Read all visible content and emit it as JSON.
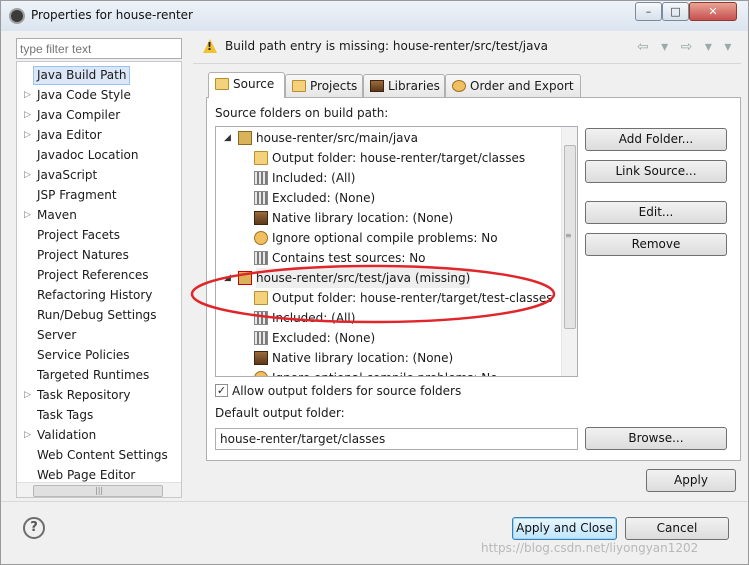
{
  "window": {
    "title": "Properties for house-renter",
    "minimize_glyph": "–",
    "maximize_glyph": "□",
    "close_glyph": "✕"
  },
  "left": {
    "filter_placeholder": "type filter text",
    "items": [
      {
        "label": "Java Build Path",
        "expandable": false,
        "selected": true
      },
      {
        "label": "Java Code Style",
        "expandable": true
      },
      {
        "label": "Java Compiler",
        "expandable": true
      },
      {
        "label": "Java Editor",
        "expandable": true
      },
      {
        "label": "Javadoc Location",
        "expandable": false
      },
      {
        "label": "JavaScript",
        "expandable": true
      },
      {
        "label": "JSP Fragment",
        "expandable": false
      },
      {
        "label": "Maven",
        "expandable": true
      },
      {
        "label": "Project Facets",
        "expandable": false
      },
      {
        "label": "Project Natures",
        "expandable": false
      },
      {
        "label": "Project References",
        "expandable": false
      },
      {
        "label": "Refactoring History",
        "expandable": false
      },
      {
        "label": "Run/Debug Settings",
        "expandable": false
      },
      {
        "label": "Server",
        "expandable": false
      },
      {
        "label": "Service Policies",
        "expandable": false
      },
      {
        "label": "Targeted Runtimes",
        "expandable": false
      },
      {
        "label": "Task Repository",
        "expandable": true
      },
      {
        "label": "Task Tags",
        "expandable": false
      },
      {
        "label": "Validation",
        "expandable": true
      },
      {
        "label": "Web Content Settings",
        "expandable": false
      },
      {
        "label": "Web Page Editor",
        "expandable": false
      }
    ]
  },
  "header": {
    "message": "Build path entry is missing: house-renter/src/test/java",
    "nav_glyphs": "⇦ ▾ ⇨ ▾ ▾"
  },
  "tabs": [
    {
      "label": "Source",
      "active": true
    },
    {
      "label": "Projects"
    },
    {
      "label": "Libraries"
    },
    {
      "label": "Order and Export"
    }
  ],
  "source": {
    "heading": "Source folders on build path:",
    "tree": [
      {
        "label": "house-renter/src/main/java",
        "level": 0,
        "icon": "package-folder-icon",
        "expanded": true
      },
      {
        "label": "Output folder: house-renter/target/classes",
        "level": 1,
        "icon": "output-folder-icon"
      },
      {
        "label": "Included: (All)",
        "level": 1,
        "icon": "inclusion-filter-icon"
      },
      {
        "label": "Excluded: (None)",
        "level": 1,
        "icon": "exclusion-filter-icon"
      },
      {
        "label": "Native library location: (None)",
        "level": 1,
        "icon": "native-library-icon"
      },
      {
        "label": "Ignore optional compile problems: No",
        "level": 1,
        "icon": "optional-problems-icon"
      },
      {
        "label": "Contains test sources: No",
        "level": 1,
        "icon": "test-sources-icon"
      },
      {
        "label": "house-renter/src/test/java (missing)",
        "level": 0,
        "icon": "missing-package-folder-icon",
        "expanded": true,
        "highlight": true
      },
      {
        "label": "Output folder: house-renter/target/test-classes",
        "level": 1,
        "icon": "output-folder-icon"
      },
      {
        "label": "Included: (All)",
        "level": 1,
        "icon": "inclusion-filter-icon"
      },
      {
        "label": "Excluded: (None)",
        "level": 1,
        "icon": "exclusion-filter-icon"
      },
      {
        "label": "Native library location: (None)",
        "level": 1,
        "icon": "native-library-icon"
      },
      {
        "label": "Ignore optional compile problems: No",
        "level": 1,
        "icon": "optional-problems-icon"
      }
    ],
    "buttons": {
      "add_folder": "Add Folder...",
      "link_source": "Link Source...",
      "edit": "Edit...",
      "remove": "Remove"
    },
    "allow_output_label": "Allow output folders for source folders",
    "allow_output_checked": true,
    "default_output_label": "Default output folder:",
    "default_output_value": "house-renter/target/classes",
    "browse_label": "Browse..."
  },
  "footer": {
    "apply": "Apply",
    "apply_close": "Apply and Close",
    "cancel": "Cancel",
    "help_glyph": "?",
    "watermark": "https://blog.csdn.net/liyongyan1202"
  },
  "colors": {
    "selection": "#dbe7f7",
    "annotation_ellipse": "#e0262a",
    "warning": "#f2c12e"
  }
}
